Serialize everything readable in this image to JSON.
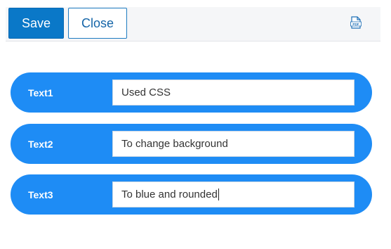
{
  "toolbar": {
    "save_label": "Save",
    "close_label": "Close",
    "pdf_icon_text": "PDF"
  },
  "form": {
    "rows": [
      {
        "label": "Text1",
        "value": "Used CSS"
      },
      {
        "label": "Text2",
        "value": "To change background"
      },
      {
        "label": "Text3",
        "value": "To blue and rounded"
      }
    ]
  },
  "colors": {
    "row_background": "#1e8cf5",
    "save_button": "#0a78c8",
    "close_text": "#1565a8",
    "toolbar_background": "#f5f6f8"
  }
}
